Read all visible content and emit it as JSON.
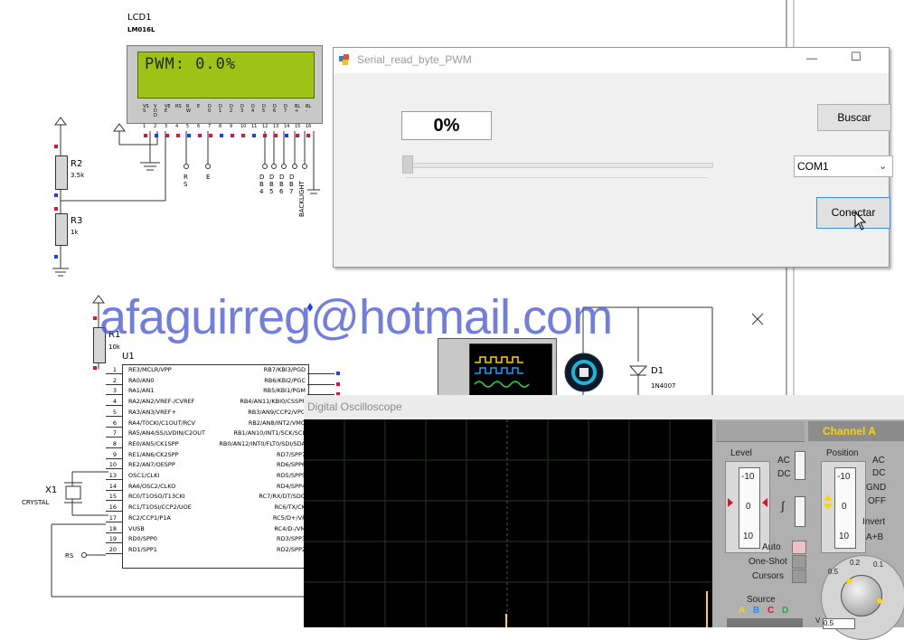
{
  "schematic": {
    "lcd": {
      "ref": "LCD1",
      "model": "LM016L",
      "display_text": "PWM: 0.0%",
      "pins": [
        "VSS",
        "VDD",
        "VEE",
        "RS",
        "RW",
        "E",
        "D0",
        "D1",
        "D2",
        "D3",
        "D4",
        "D5",
        "D6",
        "D7",
        "BL+",
        "BL-"
      ],
      "pin_numbers": [
        "1",
        "2",
        "3",
        "4",
        "5",
        "6",
        "7",
        "8",
        "9",
        "10",
        "11",
        "12",
        "13",
        "14",
        "15",
        "16"
      ],
      "bus_labels": [
        "RS",
        "E",
        "DB4",
        "DB5",
        "DB6",
        "DB7",
        "BACKLIGHT"
      ]
    },
    "r2": {
      "ref": "R2",
      "value": "3.5k"
    },
    "r3": {
      "ref": "R3",
      "value": "1k"
    },
    "r1": {
      "ref": "R1",
      "value": "10k"
    },
    "u1": {
      "ref": "U1",
      "left_pins": [
        {
          "num": "1",
          "name": "RE3/MCLR/VPP"
        },
        {
          "num": "2",
          "name": "RA0/AN0"
        },
        {
          "num": "3",
          "name": "RA1/AN1"
        },
        {
          "num": "4",
          "name": "RA2/AN2/VREF-/CVREF"
        },
        {
          "num": "5",
          "name": "RA3/AN3/VREF+"
        },
        {
          "num": "6",
          "name": "RA4/T0CKI/C1OUT/RCV"
        },
        {
          "num": "7",
          "name": "RA5/AN4/SS/LVDIN/C2OUT"
        },
        {
          "num": "8",
          "name": "RE0/AN5/CK1SPP"
        },
        {
          "num": "9",
          "name": "RE1/AN6/CK2SPP"
        },
        {
          "num": "10",
          "name": "RE2/AN7/OESPP"
        },
        {
          "num": "13",
          "name": "OSC1/CLKI"
        },
        {
          "num": "14",
          "name": "RA6/OSC2/CLKO"
        },
        {
          "num": "15",
          "name": "RC0/T1OSO/T13CKI"
        },
        {
          "num": "16",
          "name": "RC1/T1OSI/CCP2/UOE"
        },
        {
          "num": "17",
          "name": "RC2/CCP1/P1A"
        },
        {
          "num": "18",
          "name": "VUSB"
        },
        {
          "num": "19",
          "name": "RD0/SPP0"
        },
        {
          "num": "20",
          "name": "RD1/SPP1"
        }
      ],
      "right_pins": [
        {
          "name": "RB7/KBI3/PGD"
        },
        {
          "name": "RB6/KBI2/PGC"
        },
        {
          "name": "RB5/KBI1/PGM"
        },
        {
          "name": "RB4/AN11/KBI0/CSSPP"
        },
        {
          "name": "RB3/AN9/CCP2/VPO"
        },
        {
          "name": "RB2/AN8/INT2/VMO"
        },
        {
          "name": "RB1/AN10/INT1/SCK/SCL"
        },
        {
          "name": "RB0/AN12/INT0/FLT0/SDI/SDA"
        },
        {
          "name": "RD7/SPP7"
        },
        {
          "name": "RD6/SPP6"
        },
        {
          "name": "RD5/SPP5"
        },
        {
          "name": "RD4/SPP4"
        },
        {
          "name": "RC7/RX/DT/SDO"
        },
        {
          "name": "RC6/TX/CK"
        },
        {
          "name": "RC5/D+/VP"
        },
        {
          "name": "RC4/D-/VM"
        },
        {
          "name": "RD3/SPP3"
        },
        {
          "name": "RD2/SPP2"
        }
      ]
    },
    "x1": {
      "ref": "X1",
      "value": "CRYSTAL"
    },
    "rs_label": "RS",
    "d1": {
      "ref": "D1",
      "value": "1N4007"
    },
    "scope_pins": [
      "A",
      "B",
      "C",
      "D"
    ]
  },
  "watermark": "afaguirreg@hotmail.com",
  "dialog": {
    "title": "Serial_read_byte_PWM",
    "minimize_label": "—",
    "maximize_label": "☐",
    "percent_label": "0%",
    "slider_value": 0,
    "buscar_label": "Buscar",
    "port_selected": "COM1",
    "conectar_label": "Conectar"
  },
  "oscilloscope": {
    "title": "Digital Oscilloscope",
    "channel_label": "Channel A",
    "level_label": "Level",
    "position_label": "Position",
    "level_ticks": [
      "-10",
      "0",
      "10"
    ],
    "position_ticks": [
      "-10",
      "0",
      "10"
    ],
    "coupling_ac": "AC",
    "coupling_dc": "DC",
    "pos_ac": "AC",
    "pos_dc": "DC",
    "pos_gnd": "GND",
    "pos_off": "OFF",
    "invert": "Invert",
    "a_plus_b": "A+B",
    "auto": "Auto",
    "one_shot": "One-Shot",
    "cursors": "Cursors",
    "source": "Source",
    "sources": [
      "A",
      "B",
      "C",
      "D"
    ],
    "volts_ticks": [
      "0.5",
      "0.2",
      "0.1"
    ],
    "volts_unit": "V",
    "volts_value": "0.5"
  },
  "colors": {
    "lcd_bg": "#9dc316",
    "watermark": "#4b5bd6",
    "pin_red": "#e0103a",
    "pin_blue": "#1a3cff",
    "channel_a": "#ffd400"
  }
}
